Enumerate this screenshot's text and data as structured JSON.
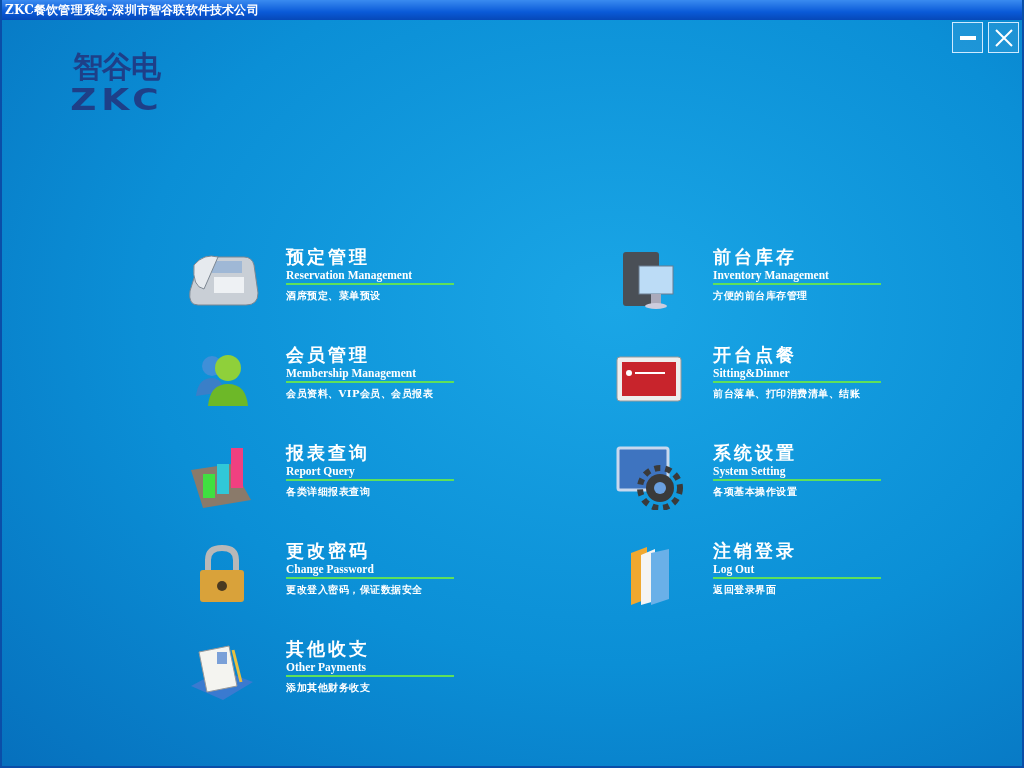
{
  "window": {
    "title": "ZKC餐饮管理系统-深圳市智谷联软件技术公司"
  },
  "logo": {
    "chinese": "智谷电",
    "latin": "ZKC"
  },
  "menu": [
    {
      "title": "预定管理",
      "subtitle": "Reservation Management",
      "description": "酒席预定、菜单预设"
    },
    {
      "title": "前台库存",
      "subtitle": "Inventory Management",
      "description": "方便的前台库存管理"
    },
    {
      "title": "会员管理",
      "subtitle": "Membership Management",
      "description": "会员资料、VIP会员、会员报表"
    },
    {
      "title": "开台点餐",
      "subtitle": "Sitting&Dinner",
      "description": "前台落单、打印消费清单、结账"
    },
    {
      "title": "报表查询",
      "subtitle": "Report Query",
      "description": "各类详细报表查询"
    },
    {
      "title": "系统设置",
      "subtitle": "System Setting",
      "description": "各项基本操作设置"
    },
    {
      "title": "更改密码",
      "subtitle": "Change Password",
      "description": "更改登入密码，保证数据安全"
    },
    {
      "title": "注销登录",
      "subtitle": "Log Out",
      "description": "返回登录界面"
    },
    {
      "title": "其他收支",
      "subtitle": "Other Payments",
      "description": "添加其他财务收支"
    }
  ]
}
